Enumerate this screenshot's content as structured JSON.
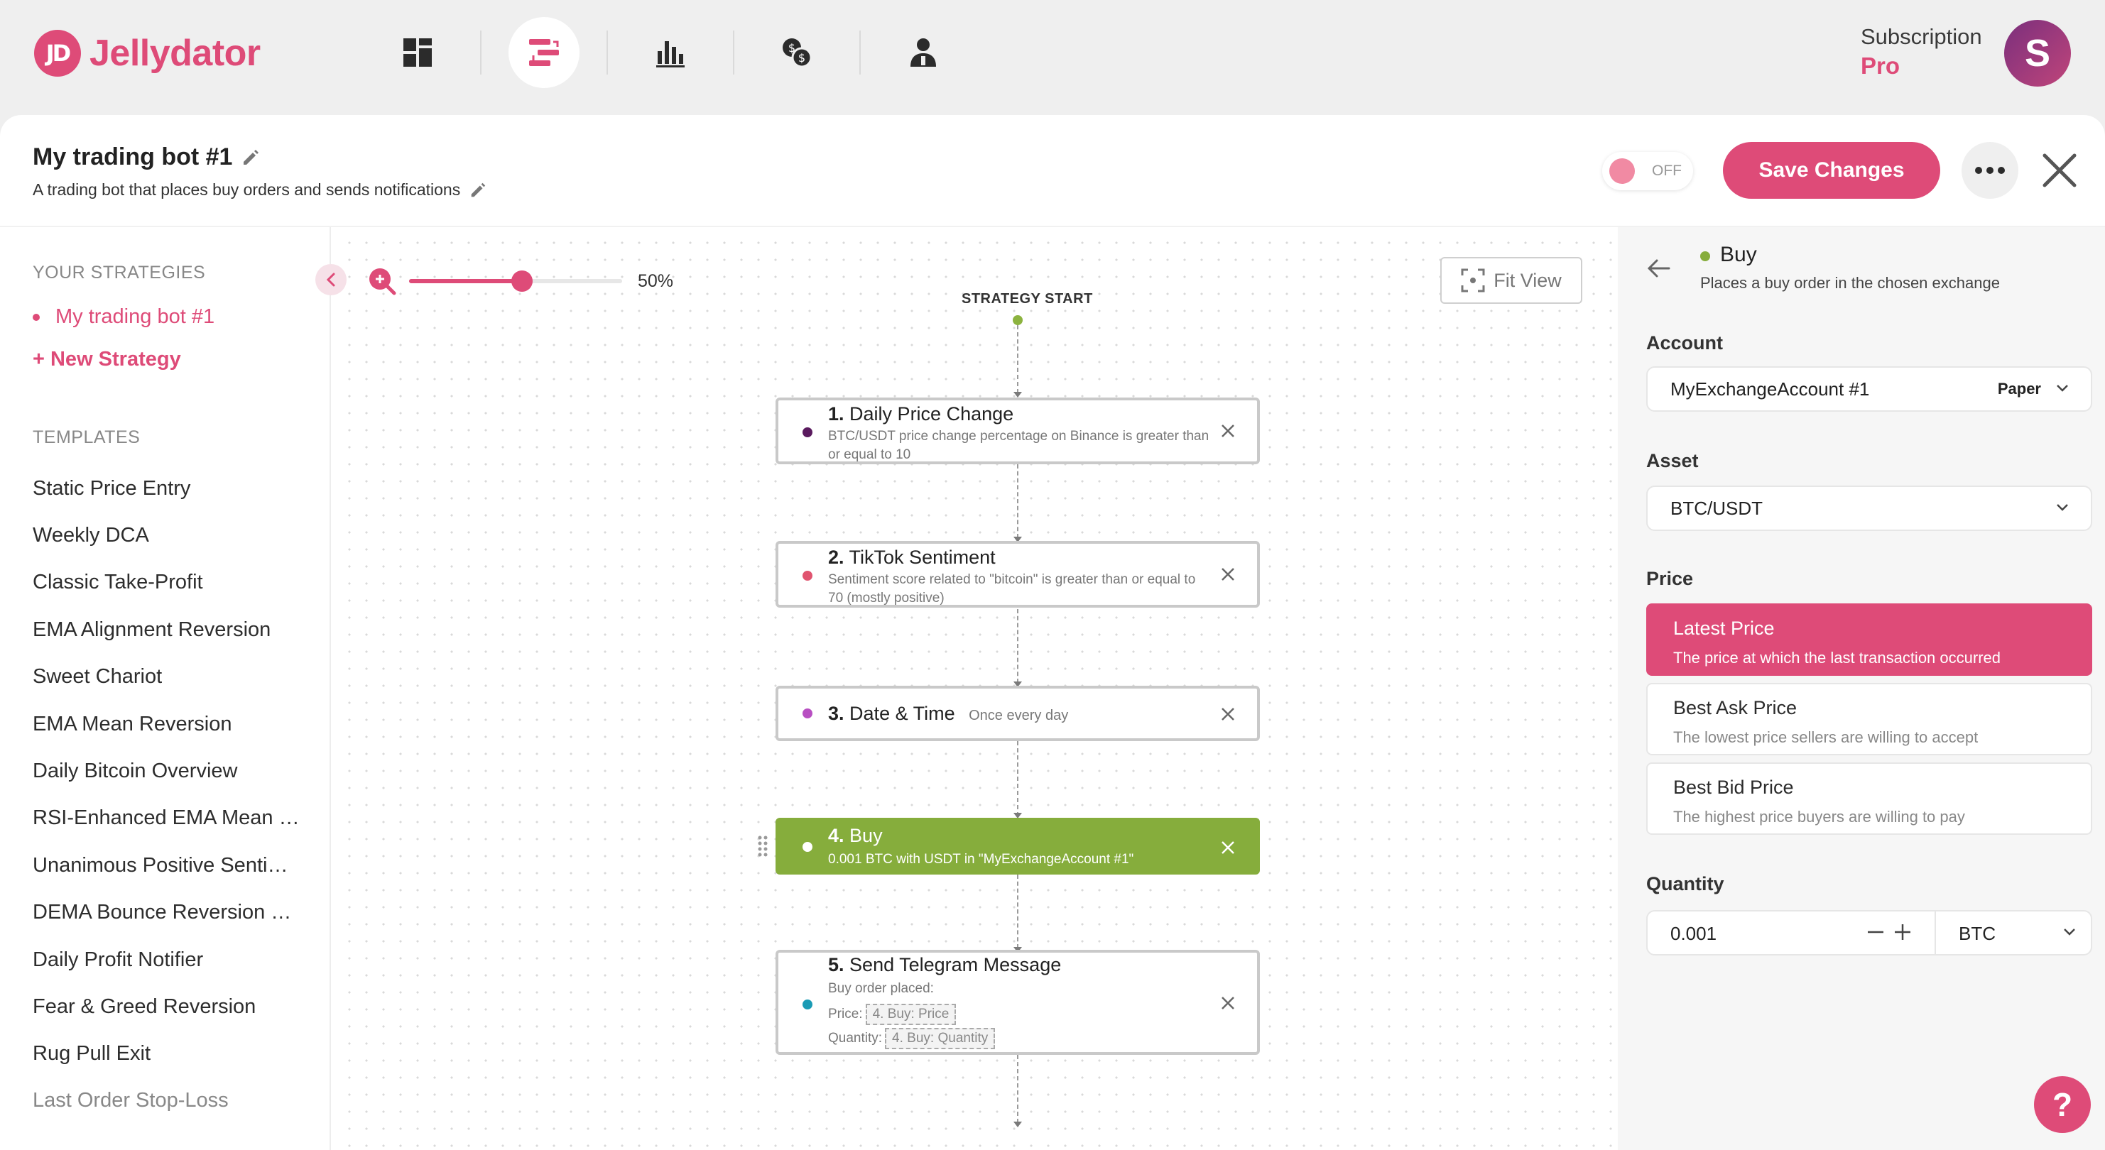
{
  "app": {
    "name": "Jellydator",
    "logo_mark": "JD"
  },
  "nav": {
    "items": [
      {
        "icon": "dashboard-icon",
        "active": false
      },
      {
        "icon": "strategies-icon",
        "active": true
      },
      {
        "icon": "bar-chart-icon",
        "active": false
      },
      {
        "icon": "exchange-currency-icon",
        "active": false
      },
      {
        "icon": "user-icon",
        "active": false
      }
    ]
  },
  "subscription": {
    "label": "Subscription",
    "plan": "Pro"
  },
  "user": {
    "avatar_letter": "S"
  },
  "bot": {
    "title": "My trading bot #1",
    "description": "A trading bot that places buy orders and sends notifications",
    "toggle_label": "OFF",
    "save_label": "Save Changes"
  },
  "sidebar": {
    "strategies_heading": "YOUR STRATEGIES",
    "strategies": [
      "My trading bot #1"
    ],
    "new_strategy": "+ New Strategy",
    "templates_heading": "TEMPLATES",
    "templates": [
      "Static Price Entry",
      "Weekly DCA",
      "Classic Take-Profit",
      "EMA Alignment Reversion",
      "Sweet Chariot",
      "EMA Mean Reversion",
      "Daily Bitcoin Overview",
      "RSI-Enhanced EMA Mean Reversion",
      "Unanimous Positive Sentiment",
      "DEMA Bounce Reversion Strategy",
      "Daily Profit Notifier",
      "Fear & Greed Reversion",
      "Rug Pull Exit",
      "Last Order Stop-Loss"
    ]
  },
  "canvas": {
    "zoom_percent": "50%",
    "zoom_fraction": 0.5,
    "fit_view": "Fit View",
    "start_label": "STRATEGY START",
    "nodes": [
      {
        "num": "1.",
        "title": "Daily Price Change",
        "sub": "BTC/USDT price change percentage on Binance is greater than or equal to 10",
        "dot": "#5a1a5e"
      },
      {
        "num": "2.",
        "title": "TikTok Sentiment",
        "sub": "Sentiment score related to \"bitcoin\" is greater than or equal to 70 (mostly positive)",
        "dot": "#e0546f"
      },
      {
        "num": "3.",
        "title": "Date & Time",
        "sub": "Once every day",
        "dot": "#b84fc2"
      },
      {
        "num": "4.",
        "title": "Buy",
        "sub": "0.001 BTC with USDT in \"MyExchangeAccount #1\"",
        "dot": "#ffffff"
      },
      {
        "num": "5.",
        "title": "Send Telegram Message",
        "sub": "Buy order placed:",
        "price_label": "Price:",
        "price_chip": "4. Buy: Price",
        "qty_label": "Quantity:",
        "qty_chip": "4. Buy: Quantity",
        "dot": "#1a9bb5"
      }
    ]
  },
  "panel": {
    "title": "Buy",
    "description": "Places a buy order in the chosen exchange",
    "account_label": "Account",
    "account_value": "MyExchangeAccount #1",
    "account_tag": "Paper",
    "asset_label": "Asset",
    "asset_value": "BTC/USDT",
    "price_label": "Price",
    "price_options": [
      {
        "title": "Latest Price",
        "desc": "The price at which the last transaction occurred",
        "selected": true
      },
      {
        "title": "Best Ask Price",
        "desc": "The lowest price sellers are willing to accept",
        "selected": false
      },
      {
        "title": "Best Bid Price",
        "desc": "The highest price buyers are willing to pay",
        "selected": false
      }
    ],
    "quantity_label": "Quantity",
    "quantity_value": "0.001",
    "quantity_unit": "BTC"
  },
  "help": "?",
  "colors": {
    "brand": "#de4b78",
    "active_node": "#86ad3c",
    "background": "#efefef"
  }
}
